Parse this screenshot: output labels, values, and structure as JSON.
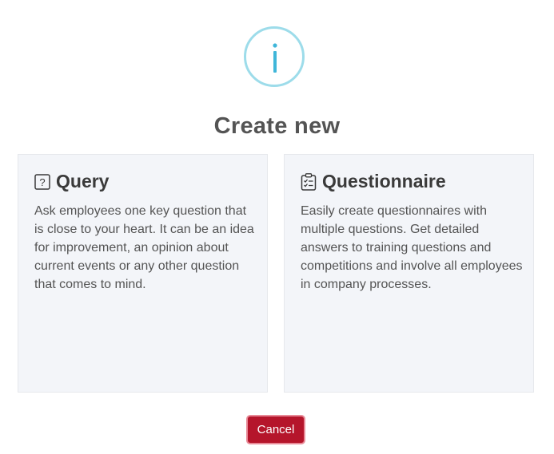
{
  "dialog": {
    "icon": "info-icon",
    "title": "Create new",
    "options": [
      {
        "icon": "question-box-icon",
        "title": "Query",
        "description": "Ask employees one key question that is close to your heart. It can be an idea for improvement, an opinion about current events or any other question that comes to mind."
      },
      {
        "icon": "clipboard-checklist-icon",
        "title": "Questionnaire",
        "description": "Easily create questionnaires with multiple questions. Get detailed answers to training questions and competitions and involve all employees in company processes."
      }
    ],
    "cancel_label": "Cancel"
  },
  "colors": {
    "accent": "#3fb6d9",
    "icon_ring": "#9ddcea",
    "cancel": "#b5152b",
    "card_background": "#f3f5f9"
  }
}
